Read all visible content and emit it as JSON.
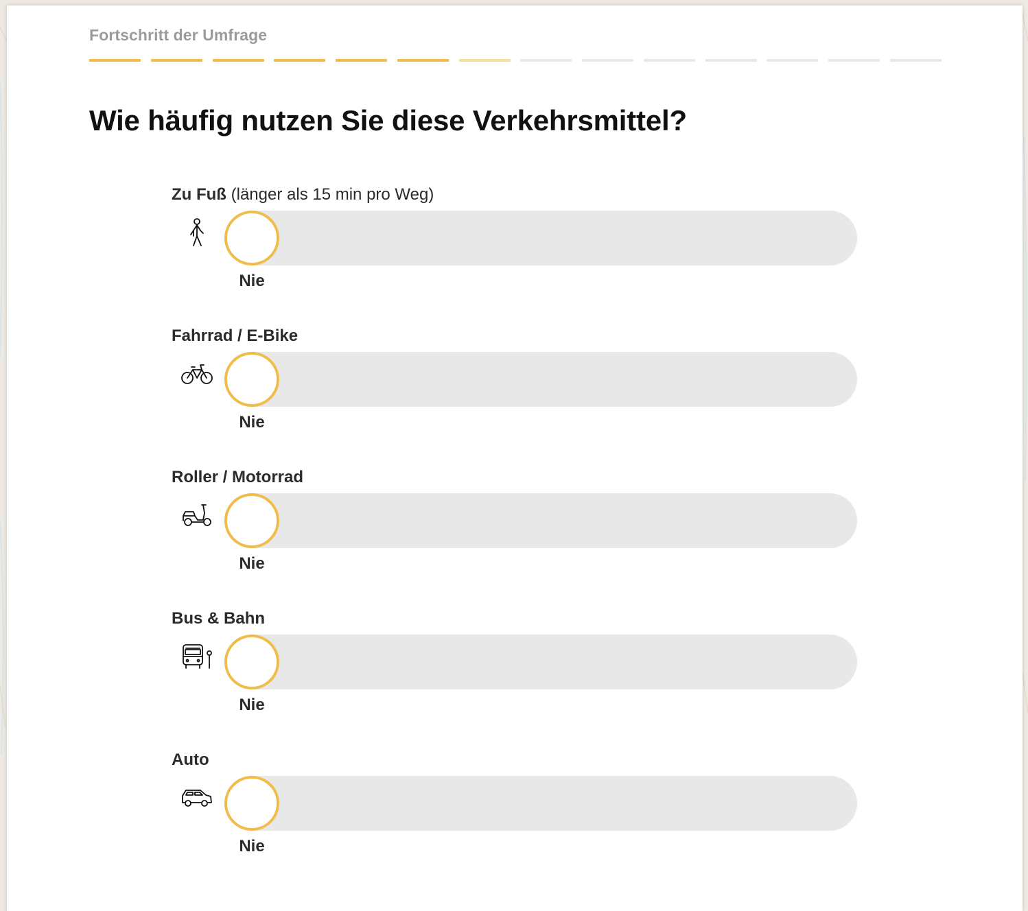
{
  "progress": {
    "label": "Fortschritt der Umfrage",
    "completed_steps": 6,
    "current_step": 7,
    "total_steps": 14,
    "colors": {
      "done": "#f0bd4a",
      "current": "#f8dfa0",
      "todo": "#e8e8e8"
    }
  },
  "question": {
    "title": "Wie häufig nutzen Sie diese Verkehrsmittel?"
  },
  "items": [
    {
      "label": "Zu Fuß",
      "sublabel": " (länger als 15 min pro Weg)",
      "icon": "walking-person-icon",
      "value": "Nie"
    },
    {
      "label": "Fahrrad / E-Bike",
      "sublabel": "",
      "icon": "bicycle-icon",
      "value": "Nie"
    },
    {
      "label": "Roller / Motorrad",
      "sublabel": "",
      "icon": "scooter-icon",
      "value": "Nie"
    },
    {
      "label": "Bus & Bahn",
      "sublabel": "",
      "icon": "bus-stop-icon",
      "value": "Nie"
    },
    {
      "label": "Auto",
      "sublabel": "",
      "icon": "car-icon",
      "value": "Nie"
    }
  ],
  "slider": {
    "knob_color": "#f0bd4a",
    "track_color": "#e8e8e8"
  }
}
